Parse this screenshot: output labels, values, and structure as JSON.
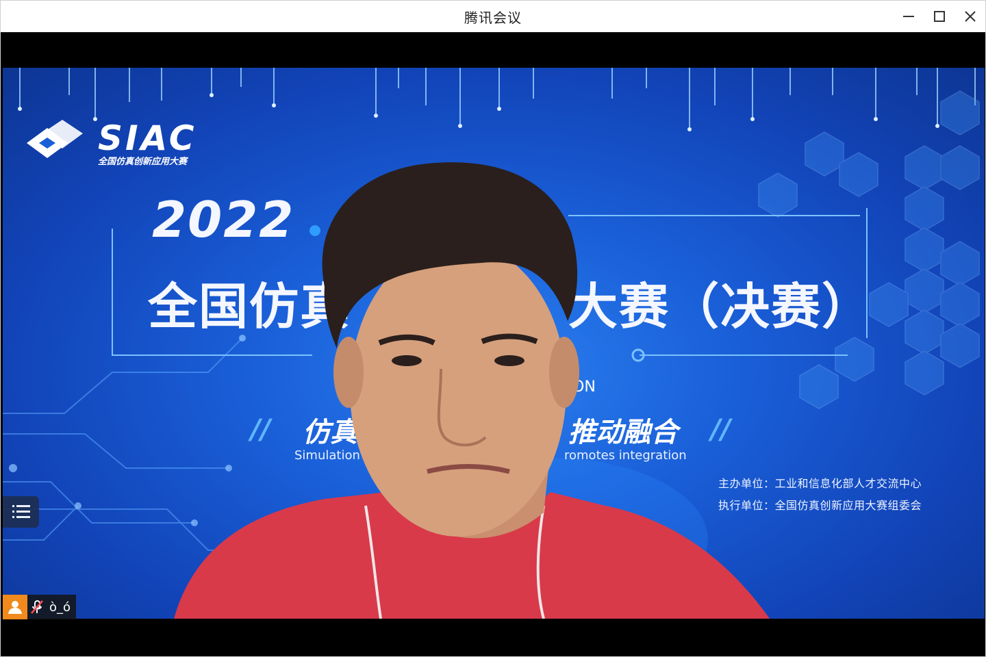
{
  "window": {
    "title": "腾讯会议"
  },
  "controls": {
    "minimize": "minimize-icon",
    "maximize": "maximize-icon",
    "close": "close-icon"
  },
  "backdrop": {
    "logo": "SIAC",
    "logo_sub": "全国仿真创新应用大赛",
    "year": "2022",
    "headline_left": "全国仿真",
    "headline_right": "大赛（决赛）",
    "en_fragment": "ON",
    "slogan_left": "仿真",
    "slogan_right": "推动融合",
    "sub_en_left": "Simulation",
    "sub_en_right": "romotes integration",
    "slash": "//",
    "org_host": "主办单位：工业和信息化部人才交流中心",
    "org_exec": "执行单位：全国仿真创新应用大赛组委会"
  },
  "participant": {
    "name": "ò_ó",
    "muted": true
  },
  "colors": {
    "accent": "#f08a1c",
    "bg_blue": "#1a5fd8",
    "shirt": "#d83a4a"
  }
}
